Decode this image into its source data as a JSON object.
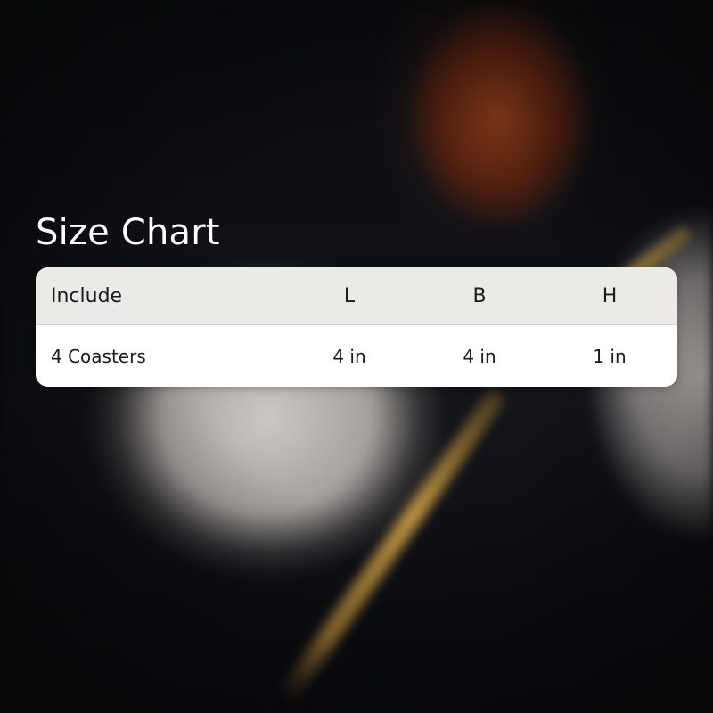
{
  "title": "Size Chart",
  "table": {
    "headers": [
      "Include",
      "L",
      "B",
      "H"
    ],
    "rows": [
      [
        "4 Coasters",
        "4 in",
        "4 in",
        "1 in"
      ]
    ]
  },
  "colors": {
    "header_bg": "#ebeae7",
    "row_bg": "#ffffff",
    "title_text": "#ffffff",
    "cell_text": "#1a1a1a"
  }
}
